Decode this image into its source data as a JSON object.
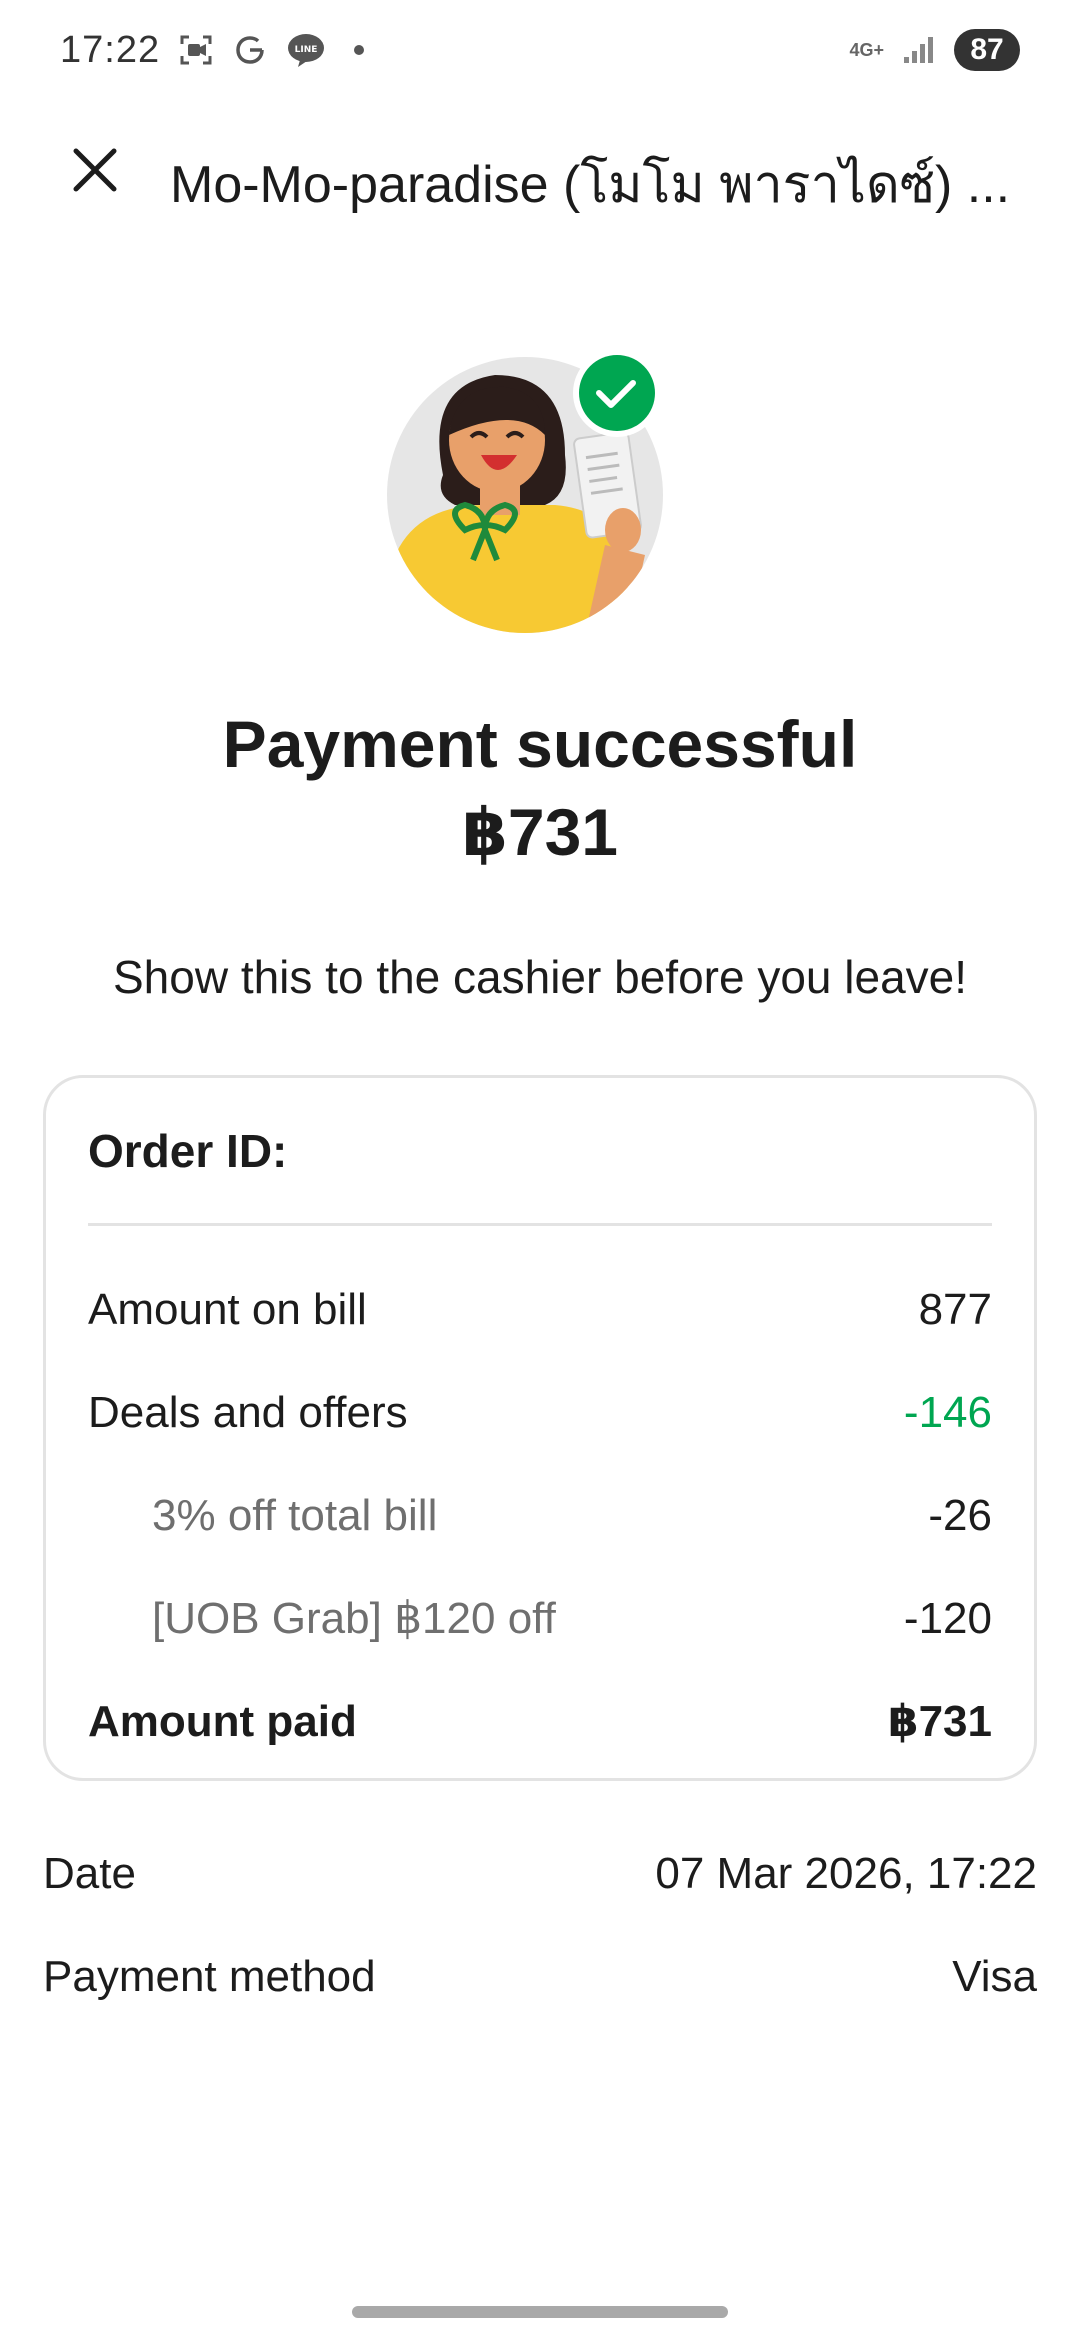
{
  "status_bar": {
    "time": "17:22",
    "network": "4G+",
    "battery": "87",
    "icons": [
      "screen-record-icon",
      "google-icon",
      "line-icon"
    ]
  },
  "header": {
    "title": "Mo-Mo-paradise (โมโม พาราไดซ์) ..."
  },
  "illustration": {
    "name": "person-with-receipt-illustration",
    "badge": "checkmark-icon"
  },
  "headline": {
    "status": "Payment successful",
    "amount": "฿731"
  },
  "instruction": "Show this to the cashier before you leave!",
  "order": {
    "id_label": "Order ID:",
    "rows": [
      {
        "label": "Amount on bill",
        "value": "877"
      },
      {
        "label": "Deals and offers",
        "value": "-146"
      },
      {
        "label": "3% off total bill",
        "value": "-26"
      },
      {
        "label": "[UOB Grab] ฿120 off",
        "value": "-120"
      },
      {
        "label": "Amount paid",
        "value": "฿731"
      }
    ]
  },
  "details": [
    {
      "label": "Date",
      "value": "07 Mar 2026, 17:22"
    },
    {
      "label": "Payment method",
      "value": "Visa"
    }
  ],
  "colors": {
    "accent_green": "#00a651",
    "text": "#1c1c1c",
    "muted": "#6f6f6f",
    "border": "#e3e3e3",
    "illustration_yellow": "#f7c933"
  }
}
